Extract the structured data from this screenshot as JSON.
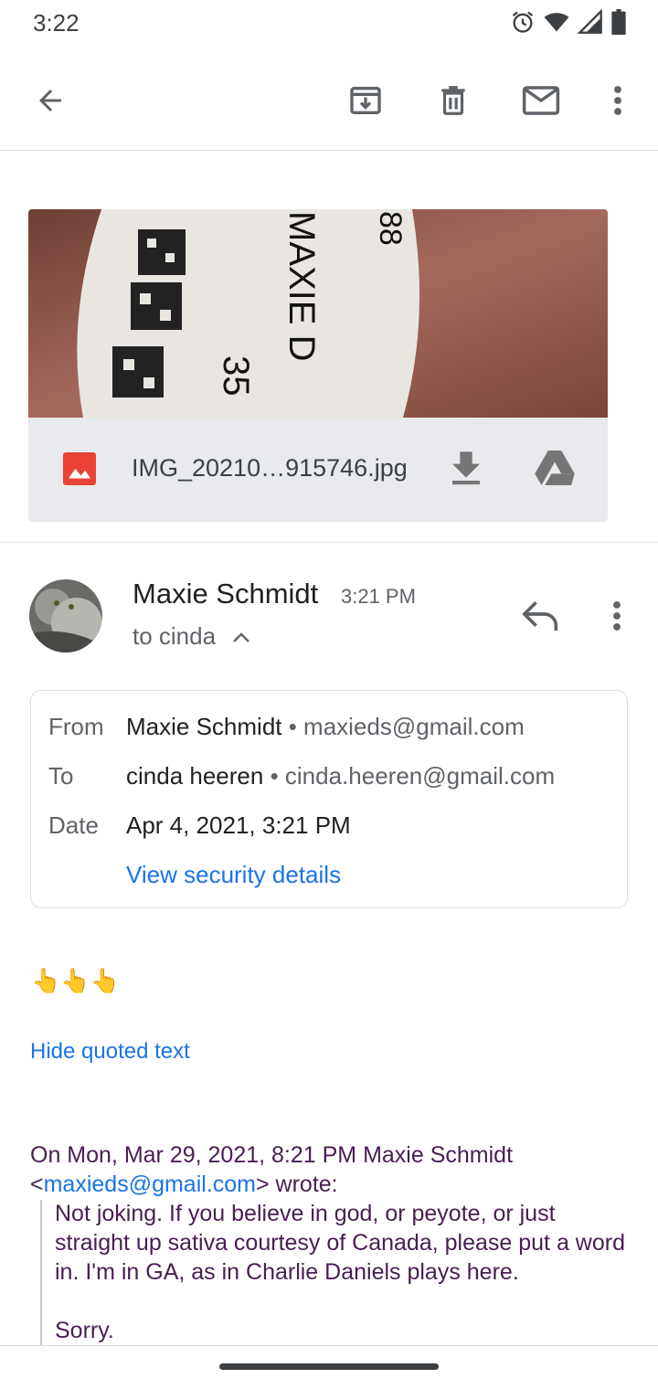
{
  "status_bar": {
    "time": "3:22",
    "icons": [
      "alarm-icon",
      "wifi-icon",
      "cell-signal-icon",
      "battery-icon"
    ]
  },
  "toolbar": {
    "back_icon": "arrow-back-icon",
    "actions": [
      "archive-icon",
      "delete-icon",
      "mark-unread-icon",
      "more-vert-icon"
    ]
  },
  "attachment": {
    "filename": "IMG_20210…915746.jpg",
    "type_icon": "image-file-icon",
    "actions": [
      "download-icon",
      "drive-icon"
    ],
    "photo_text": {
      "line1": "88",
      "line2": "MAXIE D",
      "line3": "35"
    }
  },
  "message": {
    "sender": "Maxie Schmidt",
    "time": "3:21 PM",
    "to_line": "to cinda",
    "details": {
      "from_label": "From",
      "from_name": "Maxie Schmidt",
      "from_email": "• maxieds@gmail.com",
      "to_label": "To",
      "to_name": "cinda heeren",
      "to_email": "• cinda.heeren@gmail.com",
      "date_label": "Date",
      "date_value": "Apr 4, 2021, 3:21 PM",
      "security_link": "View security details"
    },
    "body": "👆👆👆",
    "hide_quoted": "Hide quoted text",
    "quote_intro_1": "On Mon, Mar 29, 2021, 8:21 PM Maxie Schmidt",
    "quote_intro_lt": "<",
    "quote_intro_email": "maxieds@gmail.com",
    "quote_intro_2": "> wrote:",
    "quote_text": "Not joking. If you believe in god, or peyote, or just straight up sativa courtesy of Canada, please put a word in. I'm in GA, as in Charlie Daniels plays here.",
    "quote_sorry": "Sorry."
  },
  "colors": {
    "accent": "#1a73e8",
    "quote": "#4a1d54",
    "image_icon": "#ea4335"
  }
}
